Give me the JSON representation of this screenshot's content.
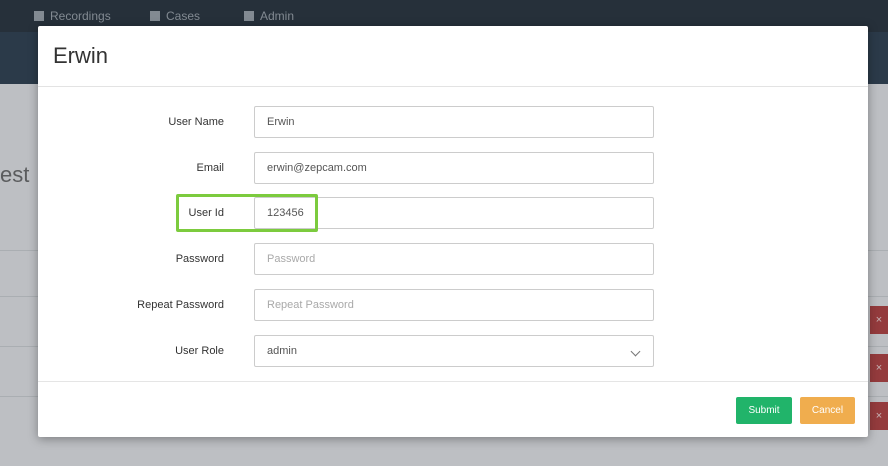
{
  "background": {
    "nav": [
      "Recordings",
      "Cases",
      "Admin"
    ],
    "page_title": "est",
    "delete_glyph": "×"
  },
  "modal": {
    "title": "Erwin",
    "fields": [
      {
        "label": "User Name",
        "value": "Erwin",
        "placeholder": ""
      },
      {
        "label": "Email",
        "value": "erwin@zepcam.com",
        "placeholder": ""
      },
      {
        "label": "User Id",
        "value": "123456",
        "placeholder": "",
        "highlighted": true
      },
      {
        "label": "Password",
        "value": "",
        "placeholder": "Password"
      },
      {
        "label": "Repeat Password",
        "value": "",
        "placeholder": "Repeat Password"
      },
      {
        "label": "User Role",
        "value": "admin",
        "type": "select",
        "icon": "chevron-down-icon"
      }
    ],
    "submit_label": "Submit",
    "cancel_label": "Cancel"
  },
  "colors": {
    "highlight": "#7ccb3e",
    "submit": "#21b46a",
    "cancel": "#f0ad4e",
    "nav_bg": "#1f2b36",
    "delete": "#b23a3a"
  }
}
